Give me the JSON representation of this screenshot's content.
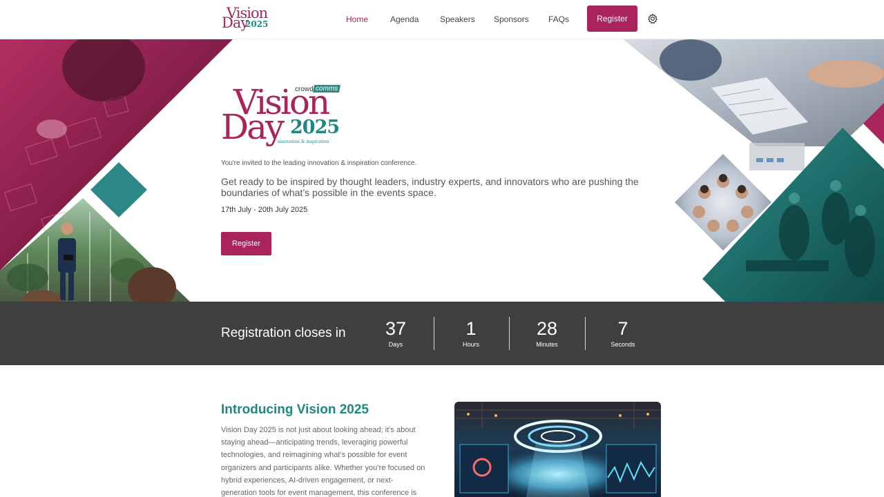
{
  "nav": {
    "logo": {
      "word1": "Vision",
      "word2": "Day",
      "year": "2025",
      "tag": "crowdcomms"
    },
    "links": [
      {
        "label": "Home",
        "active": true
      },
      {
        "label": "Agenda",
        "active": false
      },
      {
        "label": "Speakers",
        "active": false
      },
      {
        "label": "Sponsors",
        "active": false
      },
      {
        "label": "FAQs",
        "active": false
      }
    ],
    "register_label": "Register",
    "settings_icon": "gear-icon"
  },
  "hero": {
    "logo": {
      "word1": "Vision",
      "word2": "Day",
      "year": "2025",
      "brand_a": "crowd",
      "brand_b": "comms",
      "tagline": "innovation & inspiration"
    },
    "invite": "You're invited to the leading innovation & inspiration conference.",
    "description": "Get ready to be inspired by thought leaders, industry experts, and innovators who are pushing the boundaries of what’s possible in the events space.",
    "dates": "17th July - 20th July 2025",
    "register_label": "Register"
  },
  "countdown": {
    "label": "Registration closes in",
    "units": [
      {
        "value": "37",
        "name": "Days"
      },
      {
        "value": "1",
        "name": "Hours"
      },
      {
        "value": "28",
        "name": "Minutes"
      },
      {
        "value": "7",
        "name": "Seconds"
      }
    ]
  },
  "intro": {
    "title": "Introducing Vision 2025",
    "body": "Vision Day 2025 is not just about looking ahead; it’s about staying ahead—anticipating trends, leveraging powerful technologies, and reimagining what’s possible for event organizers and participants alike. Whether you’re focused on hybrid experiences, AI-driven engagement, or next-generation tools for event management, this conference is designed to"
  },
  "colors": {
    "brand": "#a8245a",
    "teal": "#1f8782",
    "countdown_bg": "#3f3f3f"
  }
}
